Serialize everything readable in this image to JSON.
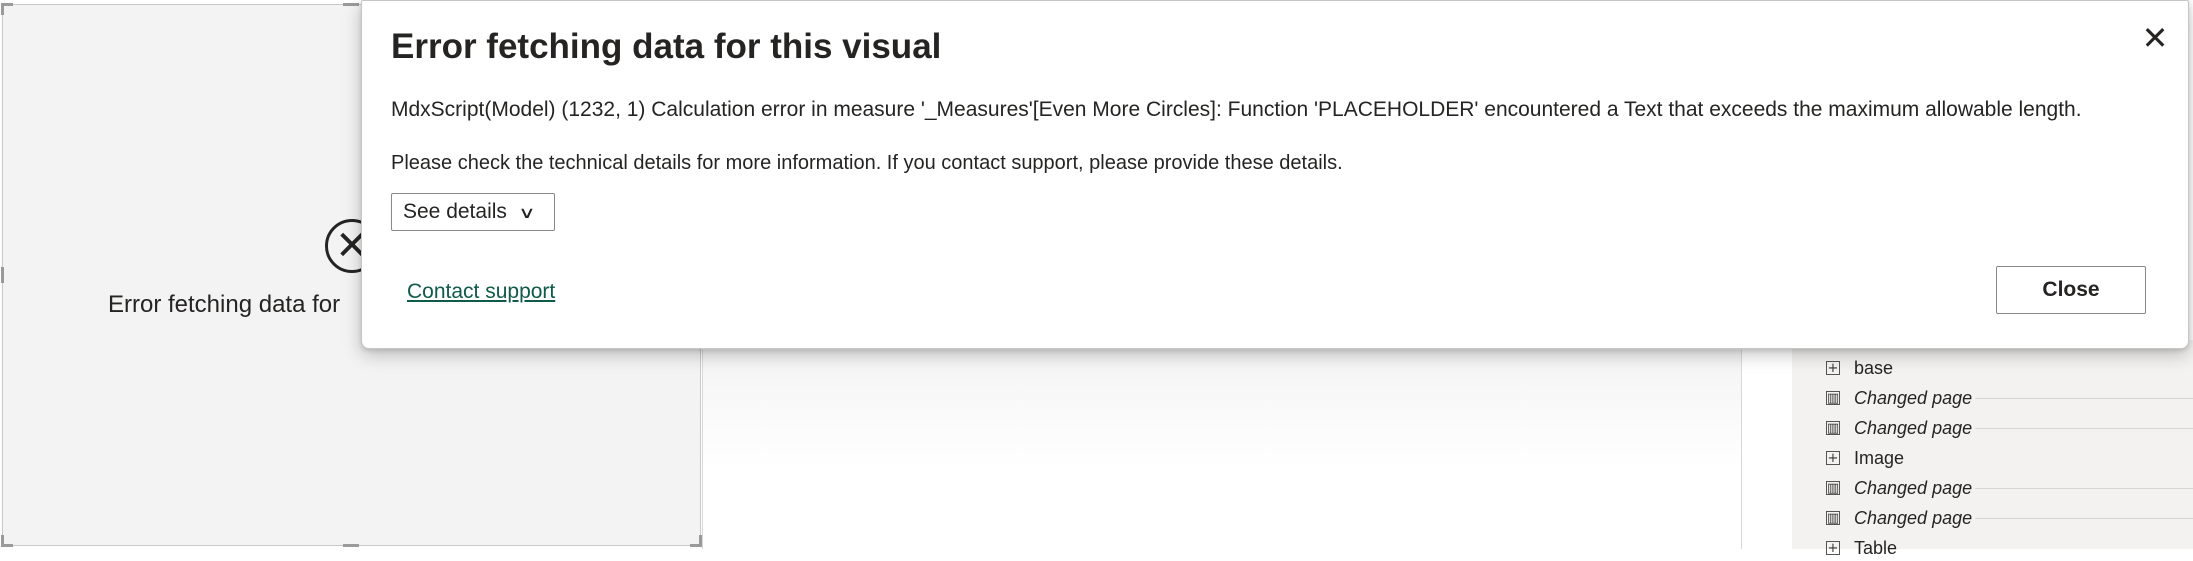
{
  "visual": {
    "error_text": "Error fetching data for"
  },
  "selection_pane": {
    "items": [
      {
        "label": "base",
        "icon": "expand-plus-icon",
        "italic": false
      },
      {
        "label": "Changed page",
        "icon": "report-page-icon",
        "italic": true
      },
      {
        "label": "Changed page",
        "icon": "report-page-icon",
        "italic": true
      },
      {
        "label": "Image",
        "icon": "expand-plus-icon",
        "italic": false
      },
      {
        "label": "Changed page",
        "icon": "report-page-icon",
        "italic": true
      },
      {
        "label": "Changed page",
        "icon": "report-page-icon",
        "italic": true
      },
      {
        "label": "Table",
        "icon": "expand-plus-icon",
        "italic": false
      }
    ]
  },
  "dialog": {
    "title": "Error fetching data for this visual",
    "close_icon": "✕",
    "error_message": "MdxScript(Model) (1232, 1) Calculation error in measure '_Measures'[Even More Circles]: Function 'PLACEHOLDER' encountered a Text that exceeds the maximum allowable length.",
    "help_message": "Please check the technical details for more information. If you contact support, please provide these details.",
    "see_details_label": "See details",
    "contact_support_label": "Contact support",
    "close_label": "Close"
  },
  "colors": {
    "link": "#0f5a49",
    "canvas": "#f3f3f3",
    "pane": "#f3f2f1"
  }
}
